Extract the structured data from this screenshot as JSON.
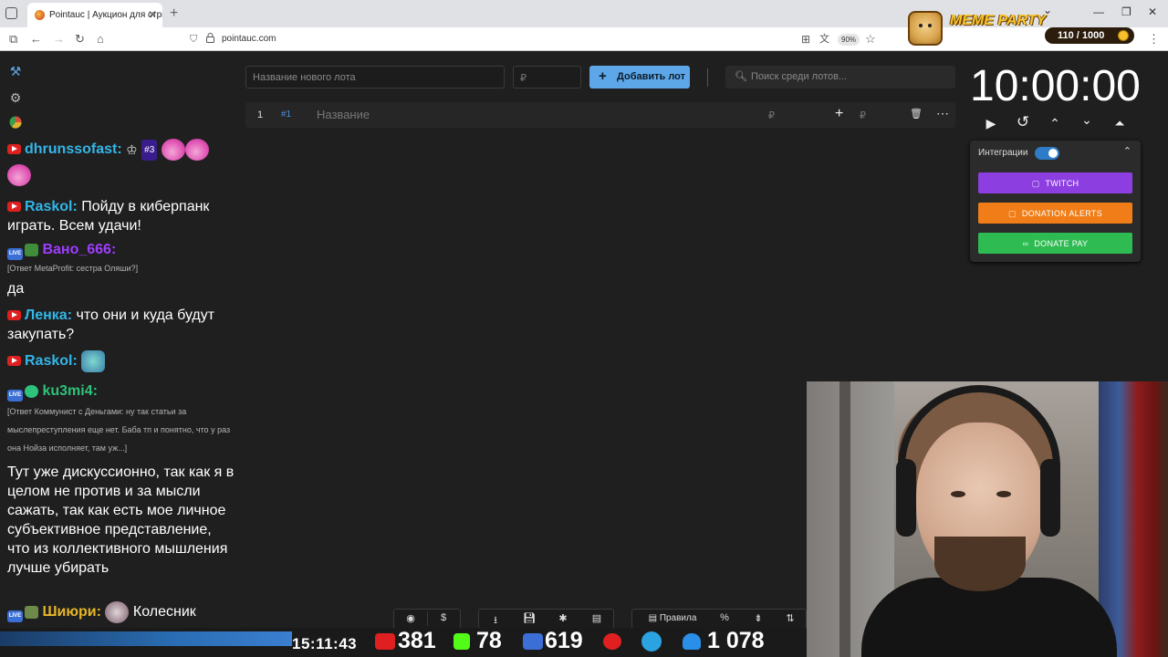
{
  "browser": {
    "tab_title": "Pointauc | Аукцион для стримеров",
    "url": "pointauc.com",
    "zoom": "90%"
  },
  "overlay": {
    "brand": "MEME PARTY",
    "points": "110 / 1000"
  },
  "lot_form": {
    "name_placeholder": "Название нового лота",
    "price_placeholder": "₽",
    "add_button": "Добавить лот",
    "search_placeholder": "Поиск среди лотов..."
  },
  "lot_rows": [
    {
      "index": "1",
      "id": "#1",
      "name_placeholder": "Название",
      "amount_symbol": "₽",
      "add_symbol": "₽"
    }
  ],
  "timer": {
    "value": "10:00:00"
  },
  "integrations": {
    "label": "Интеграции",
    "enabled": true,
    "buttons": [
      {
        "label": "TWITCH",
        "color": "#8c3ee0"
      },
      {
        "label": "DONATION ALERTS",
        "color": "#f07d17"
      },
      {
        "label": "DONATE PAY",
        "color": "#2ebc52"
      }
    ]
  },
  "chat": {
    "messages": [
      {
        "nick": "dhrunssofast:",
        "badge": "#3"
      },
      {
        "nick": "Raskol:",
        "text": "Пойду в киберпанк играть. Всем удачи!"
      },
      {
        "nick": "Вано_666:",
        "reply": "[Ответ MetaProfit: сестра Оляши?]",
        "text": "да"
      },
      {
        "nick": "Ленка:",
        "text": "что они и куда будут закупать?"
      },
      {
        "nick": "Raskol:"
      },
      {
        "nick": "ku3mi4:",
        "reply": "[Ответ Коммунист с Деньгами: ну так статьи за мыслепреступления еще нет. Баба тп и понятно, что у раз она Нойза исполняет, там уж...]",
        "text": "Тут уже дискуссионно, так как я в целом не против и за мысли сажать, так как есть мое личное субъективное представление, что из коллективного мышления лучше убирать"
      },
      {
        "nick": "Шиюри:",
        "text": "Колесник"
      }
    ]
  },
  "bottom_toolbar": {
    "rules_label": "Правила"
  },
  "stream_stats": {
    "clock": "15:11:43",
    "youtube_viewers": "381",
    "kick_viewers": "78",
    "vk_live_viewers": "619",
    "total_viewers": "1 078"
  }
}
